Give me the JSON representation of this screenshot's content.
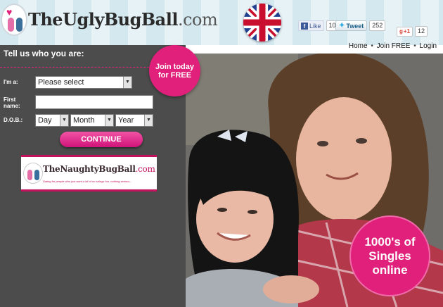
{
  "header": {
    "logo_text": "TheUglyBugBall",
    "logo_domain": ".com"
  },
  "social": {
    "like_label": "Like",
    "like_count": "10k",
    "tweet_label": "Tweet",
    "tweet_count": "252",
    "gplus_label": "+1",
    "gplus_count": "12"
  },
  "nav": {
    "home": "Home",
    "join": "Join FREE",
    "login": "Login",
    "separator": "•"
  },
  "form": {
    "title": "Tell us who you are:",
    "im_a_label": "I'm a:",
    "im_a_value": "Please select",
    "first_name_label": "First name:",
    "first_name_value": "",
    "dob_label": "D.O.B.:",
    "dob_day": "Day",
    "dob_month": "Month",
    "dob_year": "Year",
    "continue_label": "CONTINUE"
  },
  "banner": {
    "title": "TheNaughtyBugBall",
    "domain": ".com",
    "tagline": "Dating for people who just want a bit of no strings fun, nothing serious..."
  },
  "badges": {
    "join_line1": "Join today",
    "join_line2": "for FREE",
    "singles_line1": "1000's of",
    "singles_line2": "Singles",
    "singles_line3": "online"
  },
  "colors": {
    "brand_pink": "#e0207a",
    "panel_bg": "#4c4c4c",
    "header_bg": "#d4e8ef"
  }
}
